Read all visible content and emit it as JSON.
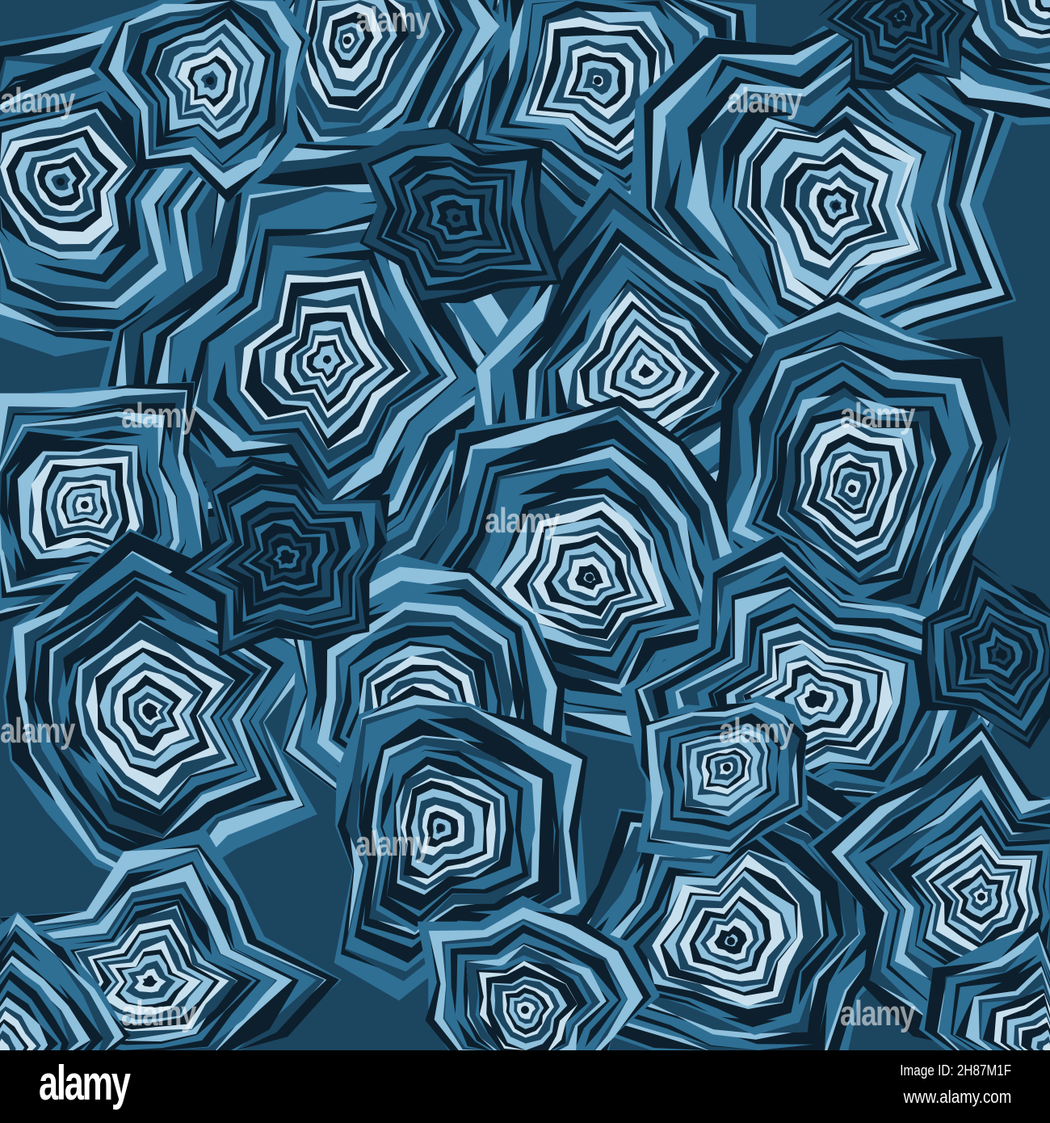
{
  "image": {
    "subject": "blue malachite-like concentric ring pattern",
    "palette": [
      "#0d1f2c",
      "#1c4560",
      "#2f6f94",
      "#8fc0dc",
      "#c8e0ee"
    ]
  },
  "watermark": {
    "text": "alamy"
  },
  "footer": {
    "logo": "alamy",
    "image_id": "Image ID: 2H87M1F",
    "url": "www.alamy.com"
  }
}
